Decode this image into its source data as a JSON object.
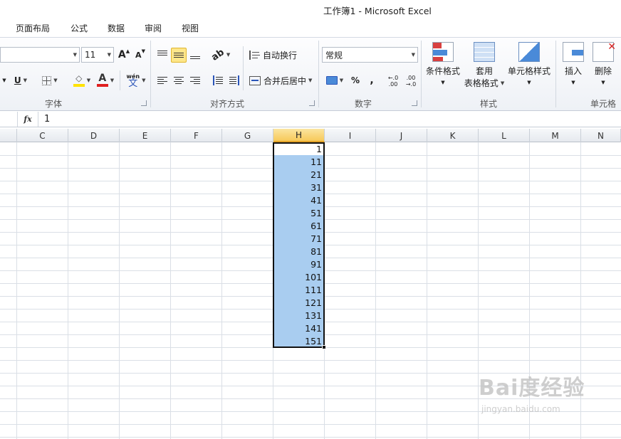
{
  "window": {
    "title": "工作簿1 - Microsoft Excel"
  },
  "tabs": [
    {
      "label": "页面布局"
    },
    {
      "label": "公式"
    },
    {
      "label": "数据"
    },
    {
      "label": "审阅"
    },
    {
      "label": "视图"
    }
  ],
  "ribbon": {
    "font": {
      "group_label": "字体",
      "font_size": "11",
      "grow_label": "A",
      "shrink_label": "A",
      "underline_label": "U",
      "font_color_label": "A",
      "phonetic_top": "wén",
      "phonetic_bottom": "文",
      "font_color": "#e02020",
      "fill_color": "#ffe300"
    },
    "alignment": {
      "group_label": "对齐方式",
      "wrap_text": "自动换行",
      "merge_center": "合并后居中"
    },
    "number": {
      "group_label": "数字",
      "format_value": "常规",
      "percent": "%",
      "comma": ",",
      "increase_decimal": "←.0 .00",
      "decrease_decimal": ".00 →.0"
    },
    "styles": {
      "group_label": "样式",
      "conditional_format": "条件格式",
      "format_table_line1": "套用",
      "format_table_line2": "表格格式",
      "cell_styles": "单元格样式"
    },
    "cells": {
      "group_label": "单元格",
      "insert": "插入",
      "delete": "删除"
    }
  },
  "formula_bar": {
    "fx": "fx",
    "content": "1"
  },
  "sheet": {
    "columns": [
      "C",
      "D",
      "E",
      "F",
      "G",
      "H",
      "I",
      "J",
      "K",
      "L",
      "M",
      "N"
    ],
    "selected_column": "H",
    "selected_range": "H1:H16",
    "column_h_values": [
      "1",
      "11",
      "21",
      "31",
      "41",
      "51",
      "61",
      "71",
      "81",
      "91",
      "101",
      "111",
      "121",
      "131",
      "141",
      "151"
    ]
  },
  "watermark": {
    "logo": "Bai度经验",
    "url": "jingyan.baidu.com"
  }
}
